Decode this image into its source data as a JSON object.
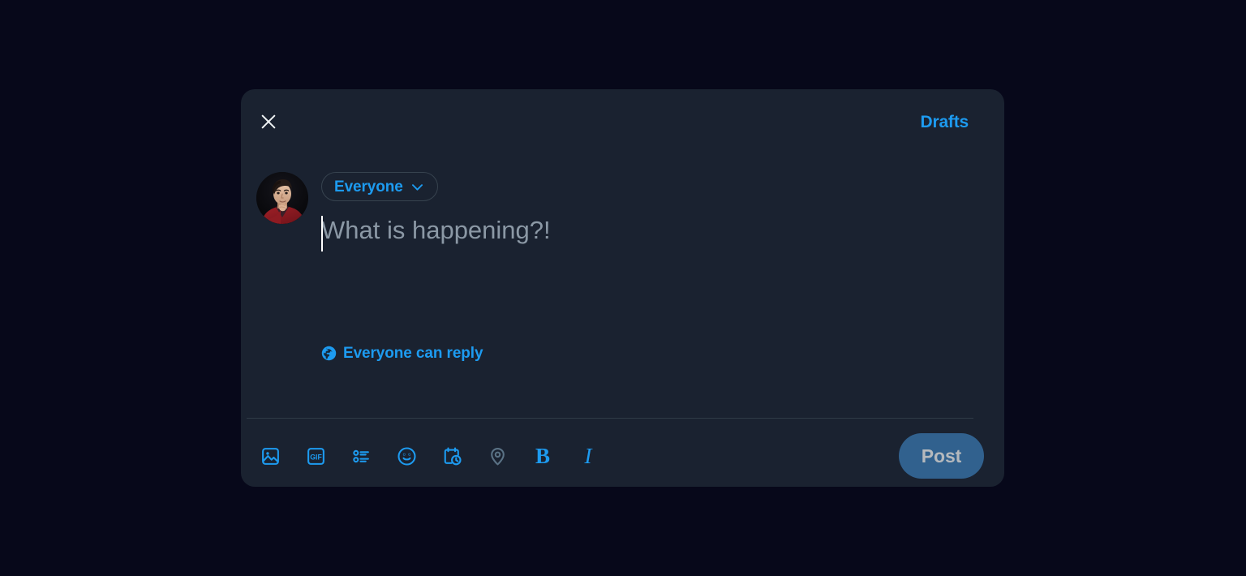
{
  "theme": {
    "page_background": "#07081a",
    "modal_background": "#1a2230",
    "accent_blue": "#1d9bf0",
    "muted_blue": "#31618e",
    "divider": "#2f3b47",
    "placeholder_text": "#8b98a5",
    "disabled_icon": "#5a7285",
    "close_icon": "#eff3f4"
  },
  "modal": {
    "name": "compose-post-modal",
    "topbar": {
      "close_icon": "close-x-icon",
      "drafts_label": "Drafts"
    },
    "author": {
      "avatar_alt": "user-profile-photo"
    },
    "audience": {
      "label": "Everyone",
      "chevron_icon": "chevron-down-icon"
    },
    "editor": {
      "value": "",
      "placeholder": "What is happening?!",
      "caret_visible": true
    },
    "reply_scope": {
      "icon": "globe-icon",
      "label": "Everyone can reply"
    },
    "toolbar": {
      "items": [
        {
          "name": "media-icon",
          "label": "Add photos or video",
          "icon": "image-icon",
          "disabled": false
        },
        {
          "name": "gif-icon",
          "label": "Add a GIF",
          "icon": "gif-icon",
          "disabled": false
        },
        {
          "name": "poll-icon",
          "label": "Add poll",
          "icon": "poll-list-icon",
          "disabled": false
        },
        {
          "name": "emoji-icon",
          "label": "Add emoji",
          "icon": "smiley-face-icon",
          "disabled": false
        },
        {
          "name": "schedule-icon",
          "label": "Schedule post",
          "icon": "calendar-clock-icon",
          "disabled": false
        },
        {
          "name": "location-icon",
          "label": "Tag location",
          "icon": "location-pin-icon",
          "disabled": true
        },
        {
          "name": "bold-icon",
          "label": "B",
          "icon": "bold-text-icon",
          "disabled": false
        },
        {
          "name": "italic-icon",
          "label": "I",
          "icon": "italic-text-icon",
          "disabled": false
        }
      ],
      "post_button_label": "Post",
      "post_button_enabled": false
    }
  }
}
